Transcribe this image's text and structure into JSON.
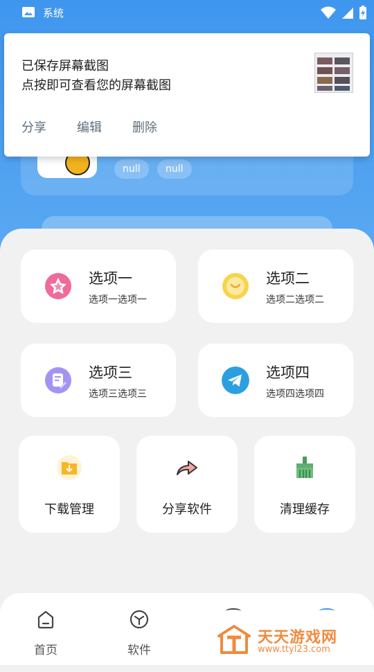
{
  "status_bar": {
    "label": "系统"
  },
  "notification": {
    "title": "已保存屏幕截图",
    "body": "点按即可查看您的屏幕截图",
    "actions": [
      "分享",
      "编辑",
      "删除"
    ]
  },
  "profile": {
    "tags": [
      "null",
      "null"
    ]
  },
  "options": [
    {
      "title": "选项一",
      "subtitle": "选项一选项一",
      "icon": "star-icon",
      "color": "#f06a9a"
    },
    {
      "title": "选项二",
      "subtitle": "选项二选项二",
      "icon": "smile-chat-icon",
      "color": "#f5c842"
    },
    {
      "title": "选项三",
      "subtitle": "选项三选项三",
      "icon": "document-edit-icon",
      "color": "#9b8cf0"
    },
    {
      "title": "选项四",
      "subtitle": "选项四选项四",
      "icon": "telegram-plane-icon",
      "color": "#2b9fe0"
    }
  ],
  "tools": [
    {
      "label": "下载管理",
      "icon": "download-folder-icon"
    },
    {
      "label": "分享软件",
      "icon": "share-arrow-icon"
    },
    {
      "label": "清理缓存",
      "icon": "broom-icon"
    }
  ],
  "nav": {
    "items": [
      "首页",
      "软件"
    ]
  },
  "watermark": {
    "name": "天天游戏网",
    "url": "www.ttyl23.com"
  }
}
